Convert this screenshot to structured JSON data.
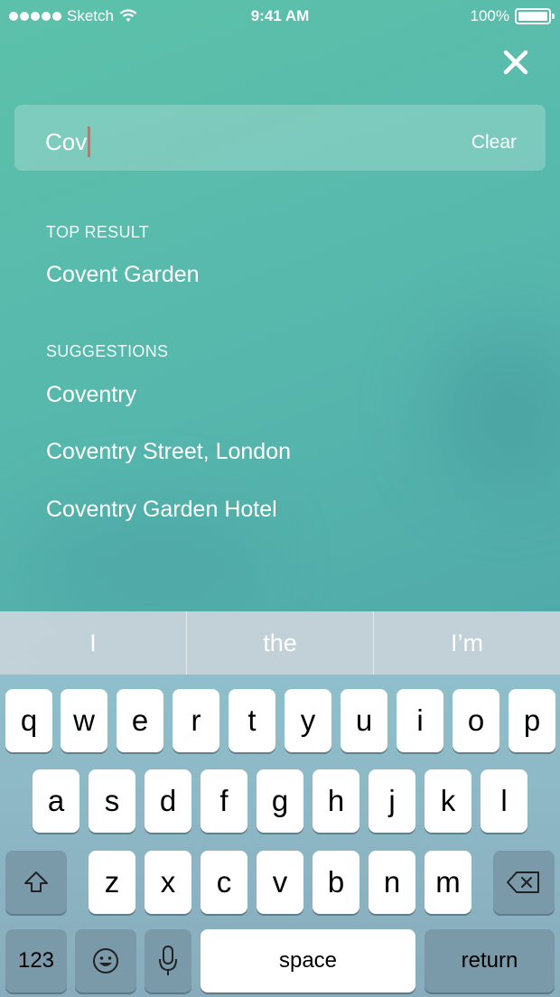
{
  "status_bar": {
    "carrier": "Sketch",
    "time": "9:41 AM",
    "battery": "100%",
    "icons": [
      "signal-dots-icon",
      "wifi-icon",
      "battery-icon"
    ]
  },
  "close_icon": "close-icon",
  "search": {
    "value": "Cov",
    "clear_label": "Clear"
  },
  "top_result": {
    "header": "TOP RESULT",
    "item": "Covent Garden"
  },
  "suggestions": {
    "header": "SUGGESTIONS",
    "items": [
      "Coventry",
      "Coventry Street, London",
      "Coventry Garden Hotel"
    ]
  },
  "keyboard": {
    "predictions": [
      "I",
      "the",
      "I’m"
    ],
    "row1": [
      "q",
      "w",
      "e",
      "r",
      "t",
      "y",
      "u",
      "i",
      "o",
      "p"
    ],
    "row2": [
      "a",
      "s",
      "d",
      "f",
      "g",
      "h",
      "j",
      "k",
      "l"
    ],
    "row3": [
      "z",
      "x",
      "c",
      "v",
      "b",
      "n",
      "m"
    ],
    "numbers_label": "123",
    "space_label": "space",
    "return_label": "return",
    "icons": [
      "shift-icon",
      "backspace-icon",
      "emoji-icon",
      "microphone-icon"
    ]
  },
  "colors": {
    "background": "#56b7ad",
    "caret": "#e0695f"
  }
}
